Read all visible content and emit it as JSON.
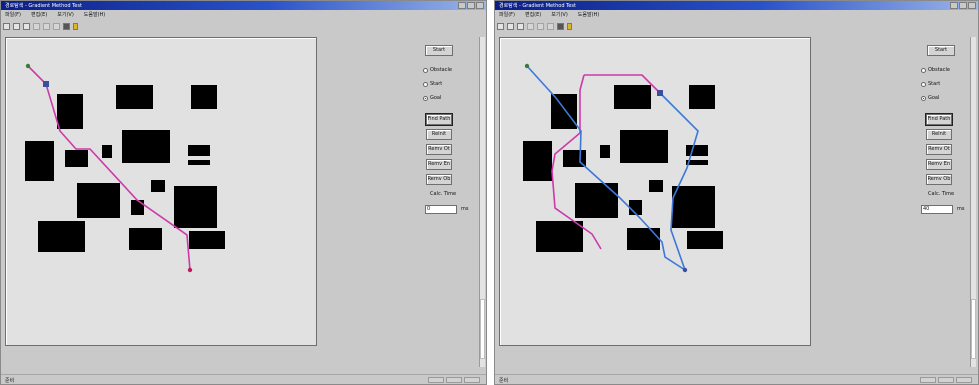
{
  "windows": [
    {
      "id": "left",
      "title": "경로탐색 - Gradient Method Test",
      "menu": [
        "파일(F)",
        "편집(E)",
        "보기(V)",
        "도움말(H)"
      ],
      "toolbar_icons": [
        "new-file-icon",
        "open-folder-icon",
        "save-icon",
        "cut-icon",
        "copy-icon",
        "paste-icon",
        "print-icon",
        "help-icon"
      ],
      "controls": {
        "start_label": "Start",
        "radio_obstacle": "Obstacle",
        "radio_start": "Start",
        "radio_goal": "Goal",
        "selected_radio": "goal",
        "find_path_label": "Find Path",
        "reinit_label": "ReInit",
        "remove_obstacle_label": "Remv Ot",
        "remove_end_label": "Remv En",
        "remove_object_label": "Remv Ob",
        "calc_time_label": "Calc. Time",
        "calc_time_value": "0",
        "unit_label": "ms"
      },
      "status_text": "준비",
      "colors": {
        "path_primary": "#cc3aa8",
        "start_marker": "#3a7b3a",
        "goal_marker": "#c2185b",
        "obstacle": "#000000"
      }
    },
    {
      "id": "right",
      "title": "경로탐색 - Gradient Method Test",
      "menu": [
        "파일(F)",
        "편집(E)",
        "보기(V)",
        "도움말(H)"
      ],
      "toolbar_icons": [
        "new-file-icon",
        "open-folder-icon",
        "save-icon",
        "cut-icon",
        "copy-icon",
        "paste-icon",
        "print-icon",
        "help-icon"
      ],
      "controls": {
        "start_label": "Start",
        "radio_obstacle": "Obstacle",
        "radio_start": "Start",
        "radio_goal": "Goal",
        "selected_radio": "goal",
        "find_path_label": "Find Path",
        "reinit_label": "ReInit",
        "remove_obstacle_label": "Remv Ot",
        "remove_end_label": "Remv En",
        "remove_object_label": "Remv Ob",
        "calc_time_label": "Calc. Time",
        "calc_time_value": "40",
        "unit_label": "ms"
      },
      "status_text": "준비",
      "colors": {
        "path_primary": "#3d78d8",
        "path_secondary": "#cc3aa8",
        "start_marker": "#3a7b3a",
        "goal_marker": "#3a4fa0",
        "obstacle": "#000000"
      }
    }
  ]
}
